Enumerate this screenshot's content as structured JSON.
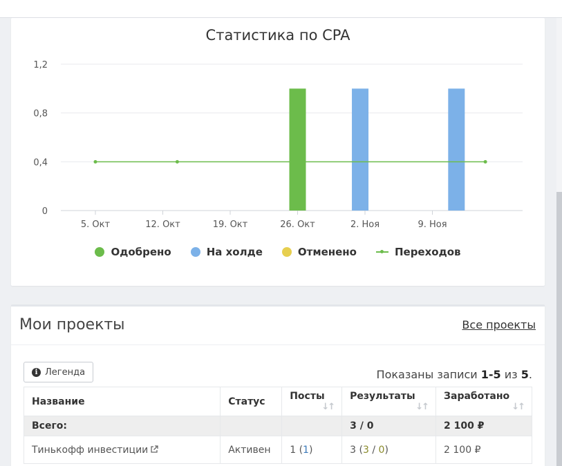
{
  "chart": {
    "title": "Статистика по CPA",
    "legend": [
      {
        "label": "Одобрено",
        "color": "#6cbc4b",
        "kind": "dot"
      },
      {
        "label": "На холде",
        "color": "#7cb1e8",
        "kind": "dot"
      },
      {
        "label": "Отменено",
        "color": "#e7cf4f",
        "kind": "dot"
      },
      {
        "label": "Переходов",
        "color": "#6cbc4b",
        "kind": "line"
      }
    ]
  },
  "chart_data": {
    "type": "bar",
    "title": "Статистика по CPA",
    "xlabel": "",
    "ylabel": "",
    "ylim": [
      0,
      1.2
    ],
    "y_ticks": [
      "0",
      "0,4",
      "0,8",
      "1,2"
    ],
    "x_ticks": [
      "5. Окт",
      "12. Окт",
      "19. Окт",
      "26. Окт",
      "2. Ноя",
      "9. Ноя"
    ],
    "x_range_days": [
      0,
      42
    ],
    "grid": true,
    "legend_position": "bottom",
    "bars": [
      {
        "series": "Одобрено",
        "day": 21,
        "value": 1
      },
      {
        "series": "На холде",
        "day": 27.5,
        "value": 1
      },
      {
        "series": "На холде",
        "day": 37.5,
        "value": 1
      }
    ],
    "line": {
      "series": "Переходов",
      "points": [
        [
          0,
          0.4
        ],
        [
          8.5,
          0.4
        ],
        [
          40.5,
          0.4
        ]
      ]
    }
  },
  "projects": {
    "title": "Мои проекты",
    "all_link": "Все проекты",
    "legend_button": "Легенда",
    "info_icon": "i",
    "records": {
      "prefix": "Показаны записи ",
      "range": "1-5",
      "mid": " из ",
      "total": "5",
      "suffix": "."
    },
    "columns": [
      "Название",
      "Статус",
      "Посты",
      "Результаты",
      "Заработано"
    ],
    "total_row": {
      "label": "Всего:",
      "status": "",
      "posts": "",
      "results": "3 / 0",
      "earned": "2 100 ₽"
    },
    "rows": [
      {
        "name": "Тинькофф инвестиции",
        "status": "Активен",
        "posts_a": "1",
        "posts_b": "1",
        "results_a": "3",
        "results_b": "3",
        "results_c": "0",
        "earned": "2 100 ₽"
      }
    ]
  }
}
